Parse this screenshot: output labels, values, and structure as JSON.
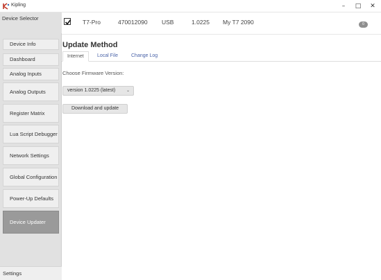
{
  "window": {
    "title": "Kipling",
    "minimize": "–",
    "maximize": "□",
    "close": "✕",
    "logo_icon": "kipling-logo-icon"
  },
  "sidebar": {
    "device_selector": "Device Selector",
    "items": [
      {
        "label": "Device Info"
      },
      {
        "label": "Dashboard"
      },
      {
        "label": "Analog Inputs"
      },
      {
        "label": "Analog Outputs"
      },
      {
        "label": "Register Matrix"
      },
      {
        "label": "Lua Script Debugger"
      },
      {
        "label": "Network Settings"
      },
      {
        "label": "Global Configuration"
      },
      {
        "label": "Power-Up Defaults"
      },
      {
        "label": "Device Updater"
      }
    ],
    "active_item": "Device Updater",
    "settings": "Settings"
  },
  "device": {
    "model": "T7-Pro",
    "serial": "470012090",
    "connection": "USB",
    "firmware": "1.0225",
    "name": "My T7 2090",
    "badge": "0",
    "checked": true
  },
  "main": {
    "title": "Update Method",
    "tabs": [
      {
        "label": "Internet"
      },
      {
        "label": "Local File"
      },
      {
        "label": "Change Log"
      }
    ],
    "active_tab": "Internet",
    "choose_label": "Choose Firmware Version:",
    "version_selected": "version 1.0225 (latest)",
    "download_button": "Download and update"
  },
  "colors": {
    "sidebar_bg": "#e1e1e1",
    "nav_item_bg": "#efefef",
    "active_nav_bg": "#9a9a9a",
    "tab_link": "#4a63a8"
  }
}
